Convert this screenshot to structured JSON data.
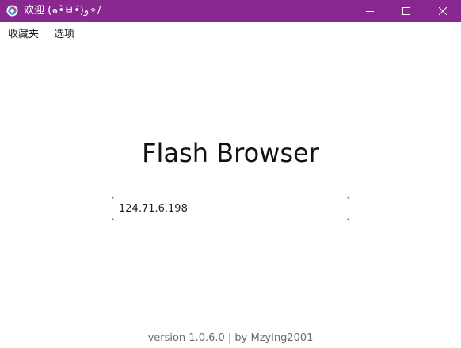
{
  "window": {
    "title": "欢迎 (๑•̀ㅂ•́)و✧/",
    "titlebar_color": "#89298f",
    "controls": {
      "minimize_icon": "minimize-icon",
      "maximize_icon": "maximize-icon",
      "close_icon": "close-icon"
    }
  },
  "menu": {
    "favorites_label": "收藏夹",
    "options_label": "选项"
  },
  "main": {
    "brand": "Flash Browser",
    "address_value": "124.71.6.198",
    "input_border_color": "#2e6fdc"
  },
  "footer": {
    "version_text": "version 1.0.6.0 | by Mzying2001"
  }
}
